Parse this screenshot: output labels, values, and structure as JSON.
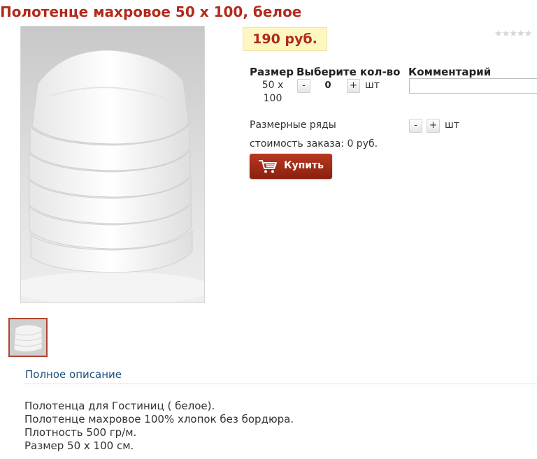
{
  "product": {
    "title": "Полотенце махровое 50 х 100, белое",
    "price": "190 руб.",
    "rating_icon": "five-empty-stars",
    "rating_value": 0
  },
  "options_table": {
    "headers": {
      "size": "Размер",
      "quantity": "Выберите кол-во",
      "comment": "Комментарий"
    },
    "row": {
      "size": "50 х 100",
      "minus_label": "-",
      "quantity": "0",
      "plus_label": "+",
      "unit": "шт",
      "comment_value": ""
    }
  },
  "size_ranges": {
    "label": "Размерные ряды",
    "minus_label": "-",
    "plus_label": "+",
    "unit": "шт"
  },
  "order_total": "стоимость заказа: 0 руб.",
  "buy_button": {
    "label": "Купить",
    "icon": "shopping-cart-icon"
  },
  "description": {
    "tab_label": "Полное описание",
    "lines": [
      "Полотенца для Гостиниц ( белое).",
      "Полотенце махровое 100% хлопок без бордюра.",
      "Плотность 500 гр/м.",
      "Размер 50 х 100 см."
    ]
  },
  "colors": {
    "title_red": "#b22a1c",
    "price_background": "#fff7c2",
    "buy_button": "#9f2a15",
    "link_blue": "#1d4f7d"
  }
}
